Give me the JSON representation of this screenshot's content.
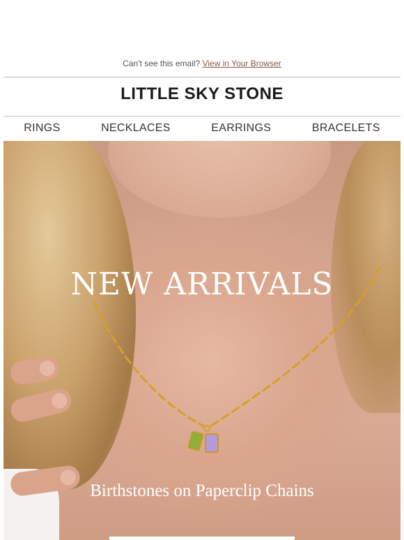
{
  "preheader": {
    "text": "Can't see this email?",
    "link_label": "View in Your Browser"
  },
  "brand": {
    "name": "LITTLE SKY STONE"
  },
  "nav": {
    "items": [
      {
        "label": "RINGS"
      },
      {
        "label": "NECKLACES"
      },
      {
        "label": "EARRINGS"
      },
      {
        "label": "BRACELETS"
      }
    ]
  },
  "hero": {
    "title": "NEW ARRIVALS",
    "subtitle": "Birthstones on Paperclip Chains",
    "image_subject": "model wearing gold paperclip chain necklace with green and purple birthstone charms"
  },
  "colors": {
    "link": "#8a5a44",
    "divider": "#bdbdbd",
    "chain_gold": "#d4a02a",
    "peridot": "#8fae3a",
    "amethyst": "#b59ad6"
  }
}
